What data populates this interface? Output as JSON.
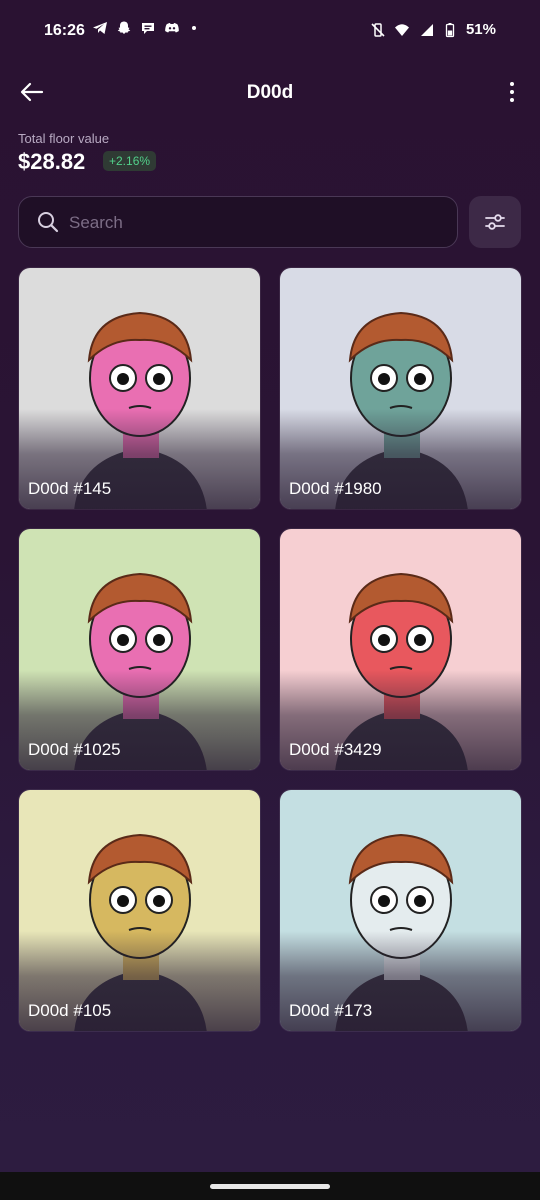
{
  "status": {
    "time": "16:26",
    "battery": "51%"
  },
  "header": {
    "title": "D00d"
  },
  "floor": {
    "label": "Total floor value",
    "value": "$28.82",
    "change": "+2.16%"
  },
  "search": {
    "placeholder": "Search"
  },
  "items": [
    {
      "name": "D00d #145",
      "bg": "#dcdcdc",
      "skin": "#e96fb2"
    },
    {
      "name": "D00d #1980",
      "bg": "#d8dbe6",
      "skin": "#6fa39a"
    },
    {
      "name": "D00d #1025",
      "bg": "#cfe3b4",
      "skin": "#e96fb2"
    },
    {
      "name": "D00d #3429",
      "bg": "#f6cfd2",
      "skin": "#e8585e"
    },
    {
      "name": "D00d #105",
      "bg": "#e8e6b8",
      "skin": "#d6b860"
    },
    {
      "name": "D00d #173",
      "bg": "#c4dfe2",
      "skin": "#e4ecee"
    }
  ],
  "colors": {
    "positive": "#52d08a",
    "accent_surface": "#3d2947"
  }
}
